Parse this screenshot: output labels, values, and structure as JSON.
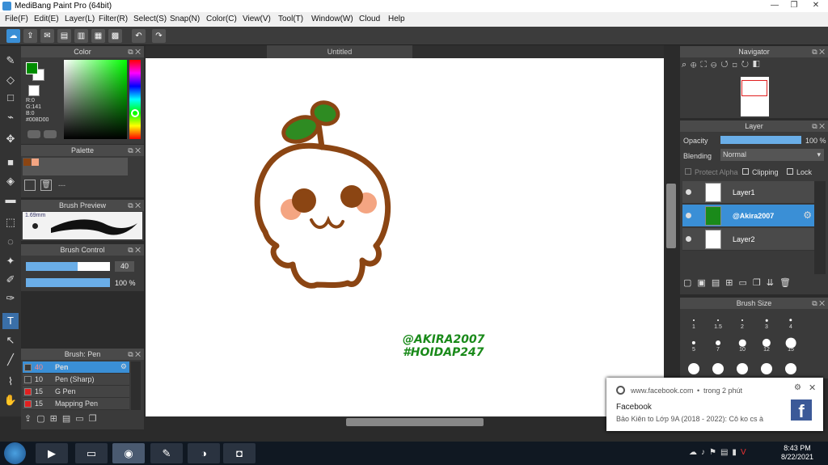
{
  "window": {
    "title": "MediBang Paint Pro (64bit)"
  },
  "menu": [
    "File(F)",
    "Edit(E)",
    "Layer(L)",
    "Filter(R)",
    "Select(S)",
    "Snap(N)",
    "Color(C)",
    "View(V)",
    "Tool(T)",
    "Window(W)",
    "Cloud",
    "Help"
  ],
  "document": {
    "tab": "Untitled"
  },
  "color_panel": {
    "title": "Color",
    "r": "R:0",
    "g": "G:141",
    "b": "B:0",
    "hex": "#008D00",
    "fg": "#008D00",
    "bg": "#ffffff"
  },
  "palette": {
    "title": "Palette",
    "dash": "---",
    "swatches": [
      "#8B4513",
      "#F4A582"
    ]
  },
  "brush_preview": {
    "title": "Brush Preview",
    "size": "1.69mm"
  },
  "brush_control": {
    "title": "Brush Control",
    "size_value": "40",
    "opacity_value": "100 %",
    "size_fill": 0.62,
    "opacity_fill": 1.0
  },
  "brush_list": {
    "title": "Brush: Pen",
    "items": [
      {
        "size": "40",
        "name": "Pen",
        "color": "#3a3a3a",
        "selected": true
      },
      {
        "size": "10",
        "name": "Pen (Sharp)",
        "color": "#3a3a3a",
        "selected": false
      },
      {
        "size": "15",
        "name": "G Pen",
        "color": "#e02020",
        "selected": false
      },
      {
        "size": "15",
        "name": "Mapping Pen",
        "color": "#e02020",
        "selected": false
      }
    ]
  },
  "navigator": {
    "title": "Navigator"
  },
  "layer_panel": {
    "title": "Layer",
    "opacity_label": "Opacity",
    "opacity_value": "100 %",
    "blending_label": "Blending",
    "blending_value": "Normal",
    "protect_alpha": "Protect Alpha",
    "clipping": "Clipping",
    "lock": "Lock",
    "layers": [
      {
        "name": "Layer1",
        "selected": false
      },
      {
        "name": "@Akira2007",
        "selected": true
      },
      {
        "name": "Layer2",
        "selected": false
      }
    ]
  },
  "brush_size": {
    "title": "Brush Size",
    "sizes": [
      "1",
      "1.5",
      "2",
      "3",
      "4",
      "5",
      "7",
      "10",
      "12",
      "15"
    ]
  },
  "canvas": {
    "watermark_line1": "@AKIRA2007",
    "watermark_line2": "#HOIDAP247",
    "stroke_color": "#8B4513",
    "leaf_color": "#2E8B22",
    "cheek_color": "#F4A582"
  },
  "notification": {
    "source": "www.facebook.com",
    "time": "trong 2 phút",
    "app": "Facebook",
    "message": "Bảo Kiên to Lớp 9A (2018 - 2022): Cô ko cs à"
  },
  "tray": {
    "time": "8:43 PM",
    "date": "8/22/2021"
  }
}
